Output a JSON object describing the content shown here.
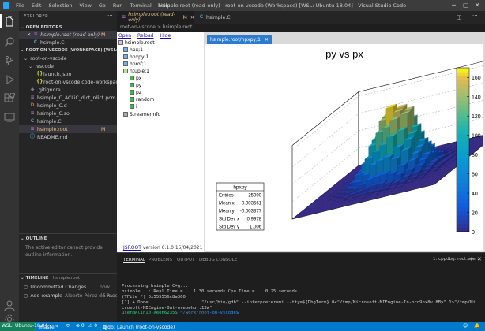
{
  "menu": [
    "File",
    "Edit",
    "Selection",
    "View",
    "Go",
    "Run",
    "Terminal",
    "Help"
  ],
  "window_title": "hsimple.root (read-only) - root-on-vscode (Workspace) [WSL: Ubuntu-18.04] - Visual Studio Code",
  "sidebar": {
    "explorer_label": "EXPLORER",
    "open_editors_label": "OPEN EDITORS",
    "open_editors": [
      {
        "name": "hsimple.root (read-only)",
        "badge": "M"
      },
      {
        "name": "hsimple.C",
        "badge": ""
      }
    ],
    "workspace_label": "ROOT-ON-VSCODE (WORKSPACE) [WSL: UBUN...",
    "folder": "root-on-vscode",
    "vscode_folder": ".vscode",
    "files": [
      {
        "name": "launch.json",
        "icon": "{}",
        "color": "#cbcb41"
      },
      {
        "name": "root-on-vscode.code-workspace",
        "icon": "{}",
        "color": "#cbcb41"
      },
      {
        "name": ".gitignore",
        "icon": "◆",
        "color": "#6d8086"
      },
      {
        "name": "hsimple_C_ACLiC_dict_rdict.pcm",
        "icon": "≡",
        "color": "#a074c4"
      },
      {
        "name": "hsimple_C.d",
        "icon": "D",
        "color": "#e44d26"
      },
      {
        "name": "hsimple_C.so",
        "icon": "≡",
        "color": "#a074c4"
      },
      {
        "name": "hsimple.C",
        "icon": "C",
        "color": "#519aba"
      },
      {
        "name": "hsimple.root",
        "icon": "≡",
        "color": "#a074c4",
        "badge": "M"
      },
      {
        "name": "README.md",
        "icon": "ⓘ",
        "color": "#519aba"
      }
    ],
    "outline_label": "OUTLINE",
    "outline_msg": "The active editor cannot provide outline information.",
    "timeline_label": "TIMELINE",
    "timeline_file": "hsimple.root",
    "timeline": [
      {
        "label": "Uncommitted Changes",
        "time": "now"
      },
      {
        "label": "Add example",
        "author": "Alberto Pérez de R...",
        "time": "5 mos"
      }
    ]
  },
  "tabs": [
    {
      "name": "hsimple.root (read-only)",
      "badge": "M",
      "active": true
    },
    {
      "name": "hsimple.C",
      "active": false
    }
  ],
  "breadcrumb": "root-on-vscode > hsimple.root",
  "tree": {
    "links": [
      "Open",
      "Reload",
      "Hide"
    ],
    "root": "hsimple.root",
    "items": [
      "hpx;1",
      "hpxpy;1",
      "hprof;1",
      "ntuple;1"
    ],
    "leaves": [
      "px",
      "py",
      "pz",
      "random",
      "i"
    ],
    "streamer": "StreamerInfo",
    "version_link": "JSROOT",
    "version_text": "version 6.1.0 15/04/2021"
  },
  "canvas_tab": "hsimple.root/hpxpy;1",
  "chart_data": {
    "type": "lego",
    "title": "py vs px",
    "colorbar": {
      "ticks": [
        0,
        20,
        40,
        60,
        80,
        100,
        120,
        140,
        160
      ],
      "range": [
        0,
        170
      ]
    },
    "stats": {
      "name": "hpxpy",
      "rows": [
        {
          "label": "Entries",
          "value": "25000"
        },
        {
          "label": "Mean x",
          "value": "-0.003561"
        },
        {
          "label": "Mean y",
          "value": "-0.003377"
        },
        {
          "label": "Std Dev x",
          "value": "0.9978"
        },
        {
          "label": "Std Dev y",
          "value": "1.006"
        }
      ]
    },
    "distribution": "2D gaussian centered at (0,0), sigma ~1"
  },
  "panel": {
    "tabs": [
      "TERMINAL",
      "PROBLEMS",
      "OUTPUT",
      "DEBUG CONSOLE"
    ],
    "terminal_name": "1: cppdbg: root.exe",
    "lines": [
      "Processing hsimple.C+g...",
      "hsimple   : Real Time =    1.30 seconds Cpu Time =    0.25 seconds",
      "(TFile *) 0x555556c8a360",
      "[1] + Done                    \"/usr/bin/gdb\" --interpreter=mi --tty=${DbgTerm} 0<\"/tmp/Microsoft-MIEngine-In-ocq9nx8v.8By\" 1>\"/tmp/Mi",
      "crosoft-MIEngine-Out-oreowhur.13w\""
    ],
    "prompt_user": "user@Alin10-Xeon6235S",
    "prompt_path": ":~/work/root-on-vscode$"
  },
  "status": {
    "remote": "WSL: Ubuntu-18.04",
    "branch": "master*",
    "sync": "⟳",
    "errors": "⊗ 0",
    "warnings": "⚠ 0",
    "debug": "(gdb) Launch (root-on-vscode)"
  }
}
